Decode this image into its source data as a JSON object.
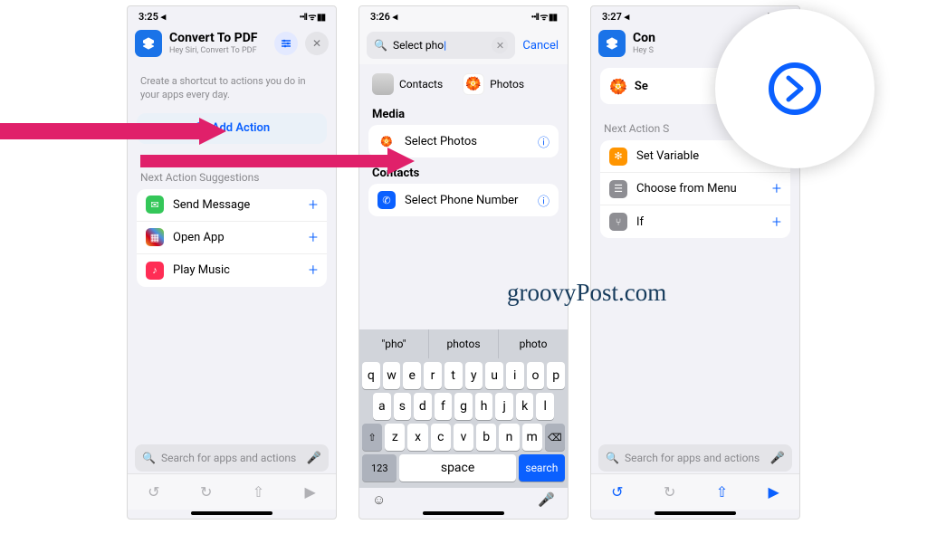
{
  "watermark": "groovyPost.com",
  "p1": {
    "time": "3:25 ◂",
    "indicators": "••ll ᯤ ▮▮",
    "title": "Convert To PDF",
    "subtitle": "Hey Siri, Convert To PDF",
    "intro": "Create a shortcut to actions you do in your apps every day.",
    "add": "Add Action",
    "sect": "Next Action Suggestions",
    "rows": [
      "Send Message",
      "Open App",
      "Play Music"
    ],
    "search": "Search for apps and actions"
  },
  "p2": {
    "time": "3:26 ◂",
    "indicators": "••ll ᯤ ▮▮",
    "query": "Select pho",
    "cancel": "Cancel",
    "cat1": "Contacts",
    "cat2": "Photos",
    "sect1": "Media",
    "row1": "Select Photos",
    "sect2": "Contacts",
    "row2": "Select Phone Number",
    "pred": [
      "\"pho\"",
      "photos",
      "photo"
    ],
    "kr1": [
      "q",
      "w",
      "e",
      "r",
      "t",
      "y",
      "u",
      "i",
      "o",
      "p"
    ],
    "kr2": [
      "a",
      "s",
      "d",
      "f",
      "g",
      "h",
      "j",
      "k",
      "l"
    ],
    "kr3": [
      "z",
      "x",
      "c",
      "v",
      "b",
      "n",
      "m"
    ],
    "k123": "123",
    "space": "space",
    "search": "search"
  },
  "p3": {
    "time": "3:27 ◂",
    "indicators": "••ll ᯤ ▮▮",
    "title": "Convert To PDF",
    "subtitle_prefix": "Hey S",
    "action": "Select photos",
    "action_visible": "Se",
    "sect": "Next Action Suggestions",
    "sect_visible": "Next Action S",
    "rows": [
      "Set Variable",
      "Choose from Menu",
      "If"
    ],
    "search": "Search for apps and actions"
  }
}
